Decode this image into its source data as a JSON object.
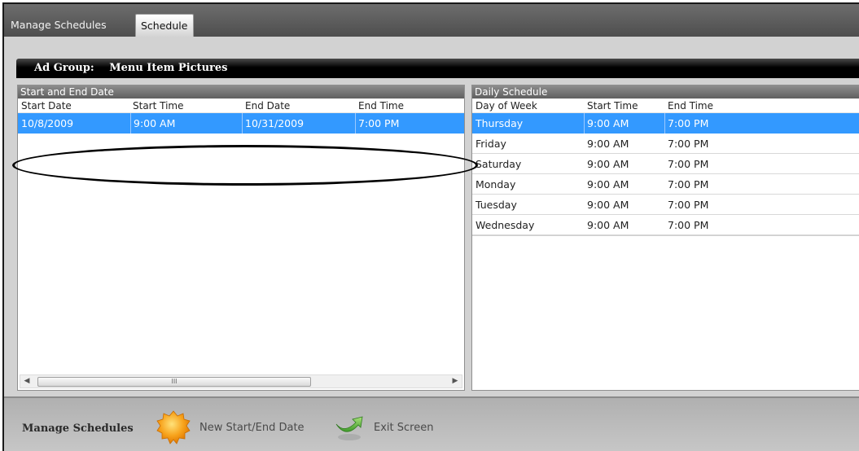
{
  "tabs": [
    {
      "label": "Manage Schedules",
      "active": false
    },
    {
      "label": "Schedule",
      "active": true
    }
  ],
  "ad_group": {
    "label": "Ad Group:",
    "value": "Menu Item Pictures"
  },
  "start_end_panel": {
    "title": "Start and End Date",
    "columns": [
      "Start Date",
      "Start Time",
      "End Date",
      "End Time"
    ],
    "rows": [
      {
        "start_date": "10/8/2009",
        "start_time": "9:00 AM",
        "end_date": "10/31/2009",
        "end_time": "7:00 PM",
        "selected": true
      }
    ],
    "scroll_grip": "III"
  },
  "daily_panel": {
    "title": "Daily Schedule",
    "columns": [
      "Day of Week",
      "Start Time",
      "End Time"
    ],
    "rows": [
      {
        "day": "Thursday",
        "start": "9:00 AM",
        "end": "7:00 PM",
        "selected": true
      },
      {
        "day": "Friday",
        "start": "9:00 AM",
        "end": "7:00 PM"
      },
      {
        "day": "Saturday",
        "start": "9:00 AM",
        "end": "7:00 PM"
      },
      {
        "day": "Monday",
        "start": "9:00 AM",
        "end": "7:00 PM"
      },
      {
        "day": "Tuesday",
        "start": "9:00 AM",
        "end": "7:00 PM"
      },
      {
        "day": "Wednesday",
        "start": "9:00 AM",
        "end": "7:00 PM"
      }
    ]
  },
  "toolbar": {
    "title": "Manage Schedules",
    "new_label": "New Start/End Date",
    "exit_label": "Exit Screen"
  },
  "colors": {
    "selection": "#3399ff",
    "new_icon": "#f7a21b",
    "exit_icon": "#6cc04a"
  }
}
